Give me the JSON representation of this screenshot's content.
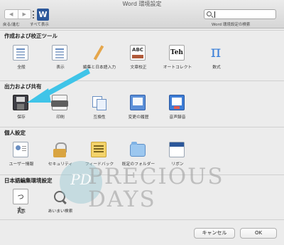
{
  "window": {
    "title": "Word 環境設定"
  },
  "toolbar": {
    "back_forward_label": "戻る/進む",
    "show_all_label": "すべて表示",
    "nav_back_glyph": "◀",
    "nav_forward_glyph": "▶",
    "show_all_logo": "W",
    "search_placeholder": "Word 環境設定の検索",
    "search_value": ""
  },
  "sections": [
    {
      "title": "作成および校正ツール",
      "items": [
        {
          "label": "全般",
          "icon": "general-icon"
        },
        {
          "label": "表示",
          "icon": "view-icon"
        },
        {
          "label": "編集と日本語入力",
          "icon": "edit-icon"
        },
        {
          "label": "文章校正",
          "icon": "proofing-icon",
          "glyph": "ABC"
        },
        {
          "label": "オートコレクト",
          "icon": "autocorrect-icon",
          "glyph": "Teh"
        },
        {
          "label": "数式",
          "icon": "equation-icon",
          "glyph": "π"
        }
      ]
    },
    {
      "title": "出力および共有",
      "items": [
        {
          "label": "保存",
          "icon": "save-icon"
        },
        {
          "label": "印刷",
          "icon": "print-icon"
        },
        {
          "label": "互換性",
          "icon": "compatibility-icon"
        },
        {
          "label": "変更の履歴",
          "icon": "track-changes-icon"
        },
        {
          "label": "音声録音",
          "icon": "audio-recording-icon"
        }
      ]
    },
    {
      "title": "個人設定",
      "items": [
        {
          "label": "ユーザー情報",
          "icon": "user-info-icon"
        },
        {
          "label": "セキュリティ",
          "icon": "security-icon"
        },
        {
          "label": "フィードバック",
          "icon": "feedback-icon"
        },
        {
          "label": "既定のフォルダー",
          "icon": "folder-icon"
        },
        {
          "label": "リボン",
          "icon": "ribbon-icon"
        }
      ]
    },
    {
      "title": "日本語編集環境設定",
      "items": [
        {
          "label": "体裁",
          "icon": "typography-icon",
          "glyph": "った"
        },
        {
          "label": "あいまい検索",
          "icon": "fuzzy-search-icon"
        }
      ]
    }
  ],
  "watermark": {
    "monogram": "PD",
    "line1": "PRECIOUS",
    "line2": "DAYS"
  },
  "buttons": {
    "cancel": "キャンセル",
    "ok": "OK"
  },
  "colors": {
    "arrow": "#3fc4e8",
    "accent": "#2b579a"
  }
}
